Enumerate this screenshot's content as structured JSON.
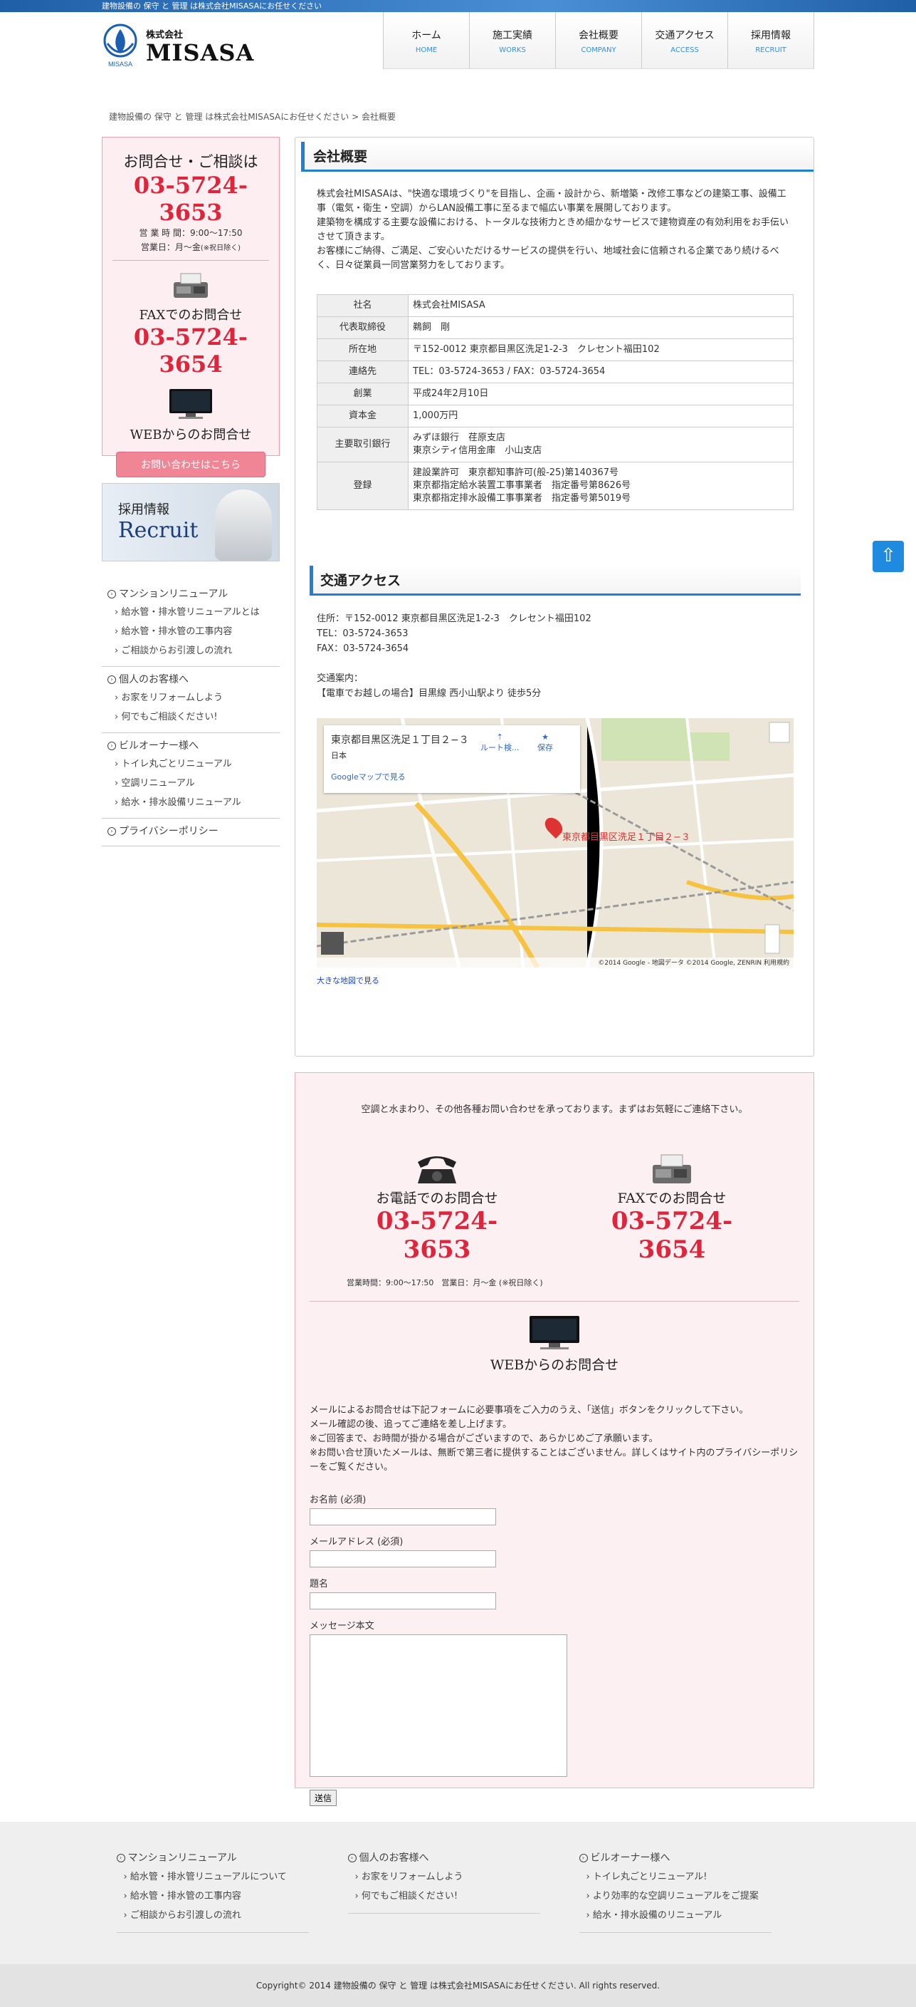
{
  "topbar": "建物設備の 保守 と 管理 は株式会社MISASAにお任せください",
  "logo": {
    "small": "株式会社",
    "big": "MISASA",
    "mark": "MISASA"
  },
  "nav": [
    {
      "jp": "ホーム",
      "en": "HOME"
    },
    {
      "jp": "施工実績",
      "en": "WORKS"
    },
    {
      "jp": "会社概要",
      "en": "COMPANY"
    },
    {
      "jp": "交通アクセス",
      "en": "ACCESS"
    },
    {
      "jp": "採用情報",
      "en": "RECRUIT"
    }
  ],
  "breadcrumb": {
    "home": "建物設備の 保守 と 管理 は株式会社MISASAにお任せください",
    "sep": ">",
    "current": "会社概要"
  },
  "sidebar": {
    "contact_title": "お問合せ・ご相談は",
    "tel": "03-5724-3653",
    "hours": "営 業 時 間：9:00〜17:50",
    "days": "営業日：月〜金",
    "days_note": "(※祝日除く)",
    "fax_title": "FAXでのお問合せ",
    "fax": "03-5724-3654",
    "web_title": "WEBからのお問合せ",
    "web_button": "お問い合わせはこちら",
    "recruit_1": "採用情報",
    "recruit_2": "Recruit",
    "groups": [
      {
        "head": "マンションリニューアル",
        "subs": [
          "給水管・排水管リニューアルとは",
          "給水管・排水管の工事内容",
          "ご相談からお引渡しの流れ"
        ]
      },
      {
        "head": "個人のお客様へ",
        "subs": [
          "お家をリフォームしよう",
          "何でもご相談ください!"
        ]
      },
      {
        "head": "ビルオーナー様へ",
        "subs": [
          "トイレ丸ごとリニューアル",
          "空調リニューアル",
          "給水・排水設備リニューアル"
        ]
      },
      {
        "head": "プライバシーポリシー",
        "subs": []
      }
    ]
  },
  "company": {
    "title": "会社概要",
    "intro": [
      "株式会社MISASAは、\"快適な環境づくり\"を目指し、企画・設計から、新増築・改修工事などの建築工事、設備工事（電気・衛生・空調）からLAN設備工事に至るまで幅広い事業を展開しております。",
      "建築物を構成する主要な設備における、トータルな技術力ときめ細かなサービスで建物資産の有効利用をお手伝いさせて頂きます。",
      "お客様にご納得、ご満足、ご安心いただけるサービスの提供を行い、地域社会に信頼される企業であり続けるべく、日々従業員一同営業努力をしております。"
    ],
    "rows": [
      {
        "k": "社名",
        "v": [
          "株式会社MISASA"
        ]
      },
      {
        "k": "代表取締役",
        "v": [
          "鵜飼　剛"
        ]
      },
      {
        "k": "所在地",
        "v": [
          "〒152-0012 東京都目黒区洗足1-2-3　クレセント福田102"
        ]
      },
      {
        "k": "連絡先",
        "v": [
          "TEL：03-5724-3653 / FAX：03-5724-3654"
        ]
      },
      {
        "k": "創業",
        "v": [
          "平成24年2月10日"
        ]
      },
      {
        "k": "資本金",
        "v": [
          "1,000万円"
        ]
      },
      {
        "k": "主要取引銀行",
        "v": [
          "みずほ銀行　荏原支店",
          "東京シティ信用金庫　小山支店"
        ]
      },
      {
        "k": "登録",
        "v": [
          "建設業許可　東京都知事許可(般-25)第140367号",
          "東京都指定給水装置工事事業者　指定番号第8626号",
          "東京都指定排水設備工事事業者　指定番号第5019号"
        ]
      }
    ]
  },
  "access": {
    "title": "交通アクセス",
    "lines": [
      "住所：〒152-0012 東京都目黒区洗足1-2-3　クレセント福田102",
      "TEL：03-5724-3653",
      "FAX：03-5724-3654",
      "",
      "交通案内：",
      "【電車でお越しの場合】目黒線 西小山駅より 徒歩5分"
    ],
    "map_title": "東京都目黒区洗足１丁目２−３",
    "map_country": "日本",
    "map_route": "ルート検...",
    "map_save": "保存",
    "map_link": "Googleマップで見る",
    "map_label": "東京都目黒区洗足１丁目２−３",
    "map_credit": "©2014 Google - 地図データ ©2014 Google, ZENRIN   利用規約",
    "large_map": "大きな地図で見る"
  },
  "inquiry": {
    "lead": "空調と水まわり、その他各種お問い合わせを承っております。まずはお気軽にご連絡下さい。",
    "tel_cap": "お電話でのお問合せ",
    "tel": "03-5724-3653",
    "fax_cap": "FAXでのお問合せ",
    "fax": "03-5724-3654",
    "hours": "営業時間：9:00〜17:50　営業日：月〜金 (※祝日除く)",
    "web_cap": "WEBからのお問合せ",
    "message": [
      "メールによるお問合せは下記フォームに必要事項をご入力のうえ、「送信」ボタンをクリックして下さい。",
      "メール確認の後、追ってご連絡を差し上げます。",
      "※ご回答まで、お時間が掛かる場合がございますので、あらかじめご了承願います。",
      "※お問い合せ頂いたメールは、無断で第三者に提供することはございません。詳しくはサイト内のプライバシーポリシーをご覧ください。"
    ],
    "name_label": "お名前 (必須)",
    "email_label": "メールアドレス (必須)",
    "subject_label": "題名",
    "body_label": "メッセージ本文",
    "submit": "送信"
  },
  "footer": {
    "cols": [
      {
        "head": "マンションリニューアル",
        "subs": [
          "給水管・排水管リニューアルについて",
          "給水管・排水管の工事内容",
          "ご相談からお引渡しの流れ"
        ]
      },
      {
        "head": "個人のお客様へ",
        "subs": [
          "お家をリフォームしよう",
          "何でもご相談ください!"
        ]
      },
      {
        "head": "ビルオーナー様へ",
        "subs": [
          "トイレ丸ごとリニューアル!",
          "より効率的な空調リニューアルをご提案",
          "給水・排水設備のリニューアル"
        ]
      }
    ],
    "copyright": "Copyright© 2014 建物設備の 保守 と 管理 は株式会社MISASAにお任せください. All rights reserved."
  },
  "colors": {
    "accent": "#1f7fd4",
    "tel_red": "#e0243a",
    "pink_bg": "#fdeef2"
  }
}
